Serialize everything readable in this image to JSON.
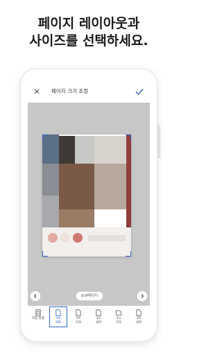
{
  "headline": {
    "line1": "페이지 레이아웃과",
    "line2": "사이즈를 선택하세요."
  },
  "toolbar": {
    "close_icon": "close-icon",
    "title": "페이지 크기 조정",
    "confirm_icon": "check-icon"
  },
  "preview": {
    "page_indicator": "6/9페이지",
    "prev_icon": "chevron-left-icon",
    "next_icon": "chevron-right-icon"
  },
  "size_options": [
    {
      "line1": "자동 맞춤",
      "line2": "",
      "icon": "auto-fit-icon",
      "selected": false
    },
    {
      "line1": "A4",
      "line2": "세로",
      "icon": "page-portrait-icon",
      "selected": true
    },
    {
      "line1": "A4",
      "line2": "가로",
      "icon": "page-landscape-icon",
      "selected": false
    },
    {
      "line1": "A3",
      "line2": "세로",
      "icon": "page-portrait-icon",
      "selected": false
    },
    {
      "line1": "A3",
      "line2": "가로",
      "icon": "page-landscape-icon",
      "selected": false
    },
    {
      "line1": "A5",
      "line2": "세로",
      "icon": "page-portrait-icon",
      "selected": false
    }
  ],
  "colors": {
    "accent": "#2c64c6",
    "canvas": "#c7c7c7"
  }
}
